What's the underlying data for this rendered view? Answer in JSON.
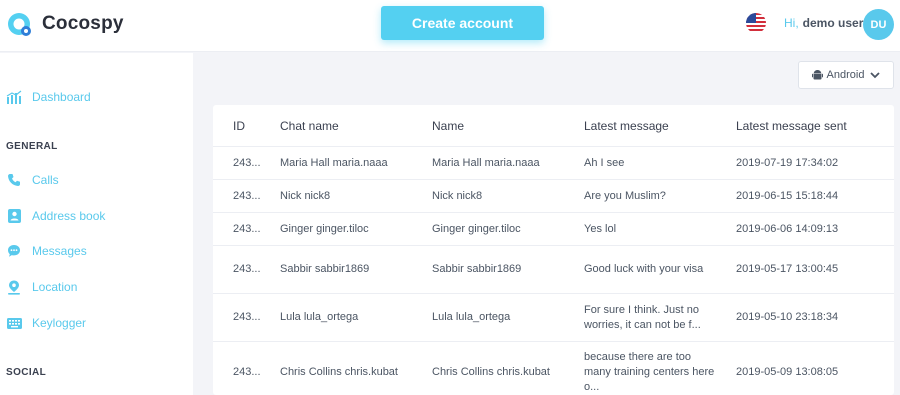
{
  "brand": {
    "name": "Cocospy"
  },
  "header": {
    "create_label": "Create account",
    "greeting": "Hi,",
    "user_name": "demo user",
    "avatar_initials": "DU"
  },
  "sidebar": {
    "dashboard": "Dashboard",
    "general_title": "GENERAL",
    "items": [
      {
        "label": "Calls",
        "icon": "phone-icon"
      },
      {
        "label": "Address book",
        "icon": "contacts-icon"
      },
      {
        "label": "Messages",
        "icon": "messages-icon"
      },
      {
        "label": "Location",
        "icon": "location-pin-icon"
      },
      {
        "label": "Keylogger",
        "icon": "keyboard-icon"
      }
    ],
    "social_title": "SOCIAL"
  },
  "device": {
    "selected": "Android"
  },
  "table": {
    "headers": [
      "ID",
      "Chat name",
      "Name",
      "Latest message",
      "Latest message sent"
    ],
    "rows": [
      {
        "id": "243...",
        "chat": "Maria Hall maria.naaa",
        "name": "Maria Hall maria.naaa",
        "msg": "Ah I see",
        "sent": "2019-07-19 17:34:02"
      },
      {
        "id": "243...",
        "chat": "Nick nick8",
        "name": "Nick nick8",
        "msg": "Are you Muslim?",
        "sent": "2019-06-15 15:18:44"
      },
      {
        "id": "243...",
        "chat": "Ginger ginger.tiloc",
        "name": "Ginger ginger.tiloc",
        "msg": "Yes lol",
        "sent": "2019-06-06 14:09:13"
      },
      {
        "id": "243...",
        "chat": "Sabbir sabbir1869",
        "name": "Sabbir sabbir1869",
        "msg": "Good luck with your visa",
        "sent": "2019-05-17 13:00:45"
      },
      {
        "id": "243...",
        "chat": "Lula lula_ortega",
        "name": "Lula lula_ortega",
        "msg": "For sure I think. Just no worries, it can not be f...",
        "sent": "2019-05-10 23:18:34"
      },
      {
        "id": "243...",
        "chat": "Chris Collins chris.kubat",
        "name": "Chris Collins chris.kubat",
        "msg": "because there are too many training centers here o...",
        "sent": "2019-05-09 13:08:05"
      }
    ]
  },
  "colors": {
    "accent": "#54d0f1",
    "text": "#4b5563",
    "background": "#f3f4f8"
  }
}
